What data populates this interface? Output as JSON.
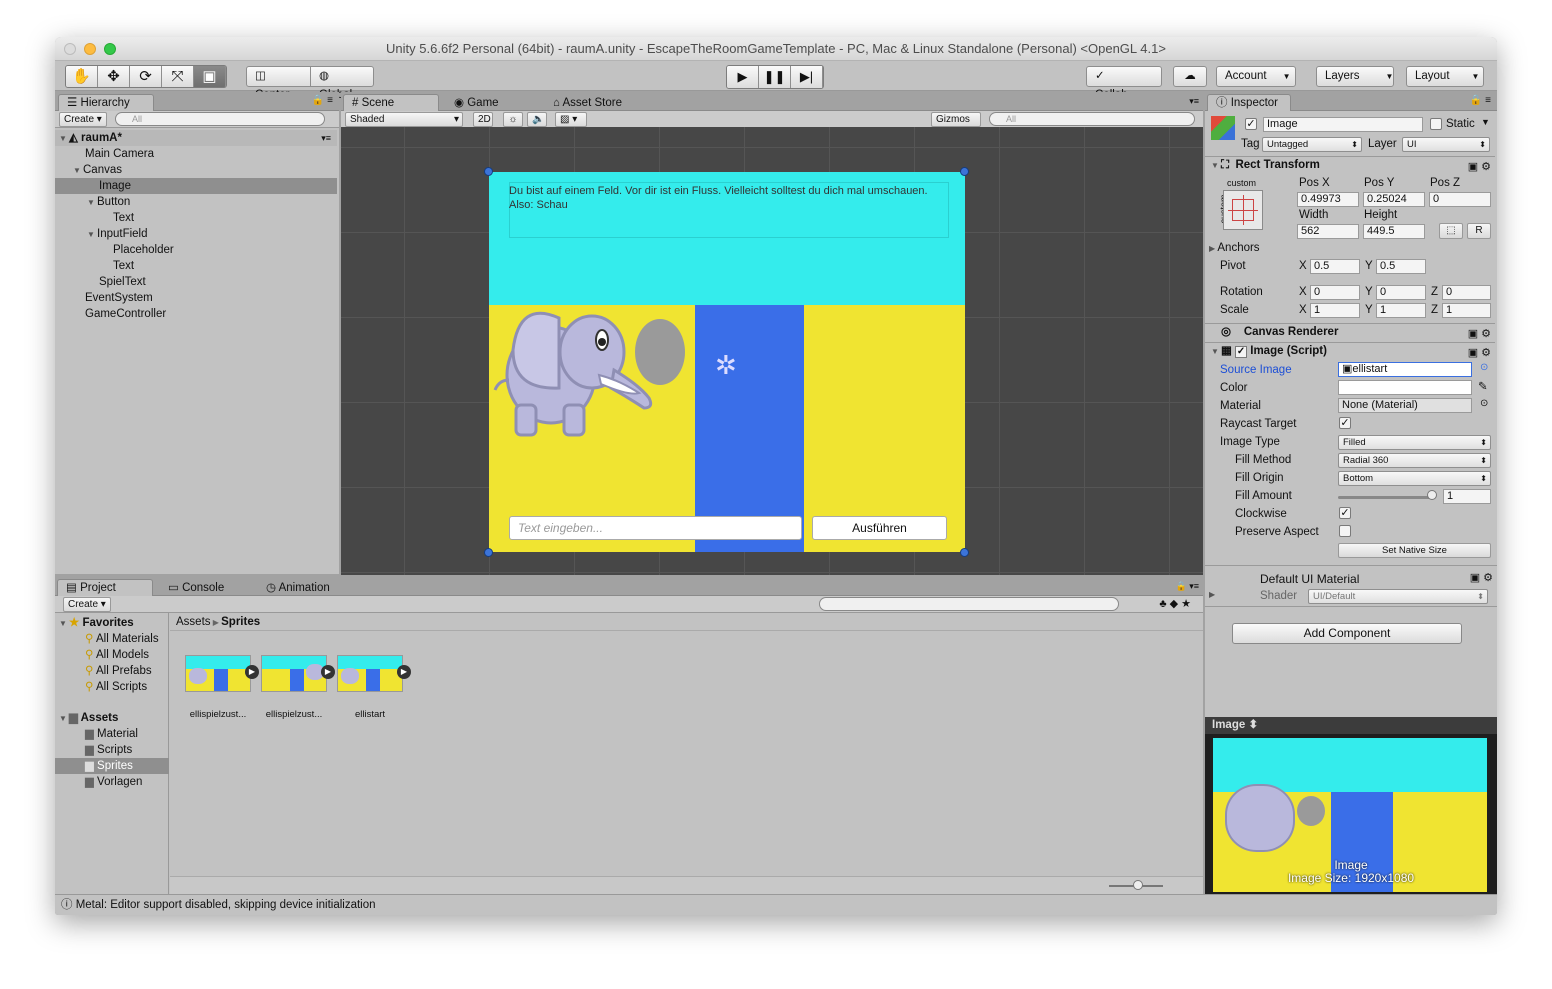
{
  "window": {
    "title": "Unity 5.6.6f2 Personal (64bit) - raumA.unity - EscapeTheRoomGameTemplate - PC, Mac & Linux Standalone (Personal) <OpenGL 4.1>"
  },
  "toolbar": {
    "center": "Center",
    "global": "Global",
    "collab": "Collab",
    "account": "Account",
    "layers": "Layers",
    "layout": "Layout"
  },
  "hierarchy": {
    "tab": "Hierarchy",
    "create": "Create",
    "search_placeholder": "All",
    "scene": "raumA*",
    "items": [
      "Main Camera",
      "Canvas",
      "Image",
      "Button",
      "Text",
      "InputField",
      "Placeholder",
      "Text",
      "SpielText",
      "EventSystem",
      "GameController"
    ]
  },
  "scene": {
    "tabs": [
      "Scene",
      "Game",
      "Asset Store"
    ],
    "shading": "Shaded",
    "mode_2d": "2D",
    "gizmos": "Gizmos",
    "search_placeholder": "All",
    "game_text": "Du bist auf einem Feld. Vor dir ist ein Fluss. Vielleicht solltest du dich mal umschauen. Also: Schau",
    "input_placeholder": "Text eingeben...",
    "button_label": "Ausführen"
  },
  "inspector": {
    "tab": "Inspector",
    "object_name": "Image",
    "static_label": "Static",
    "tag_label": "Tag",
    "tag_value": "Untagged",
    "layer_label": "Layer",
    "layer_value": "UI",
    "rect": {
      "title": "Rect Transform",
      "anchor_preset": "custom",
      "anchor_side": "custom",
      "pos_x_label": "Pos X",
      "pos_y_label": "Pos Y",
      "pos_z_label": "Pos Z",
      "pos_x": "0.49973",
      "pos_y": "0.25024",
      "pos_z": "0",
      "width_label": "Width",
      "height_label": "Height",
      "width": "562",
      "height": "449.5",
      "r_button": "R",
      "anchors": "Anchors",
      "pivot_label": "Pivot",
      "pivot_x": "0.5",
      "pivot_y": "0.5",
      "rotation_label": "Rotation",
      "rot_x": "0",
      "rot_y": "0",
      "rot_z": "0",
      "scale_label": "Scale",
      "scale_x": "1",
      "scale_y": "1",
      "scale_z": "1",
      "x": "X",
      "y": "Y",
      "z": "Z"
    },
    "canvas_renderer": "Canvas Renderer",
    "image_script": {
      "title": "Image (Script)",
      "source_image_label": "Source Image",
      "source_image": "ellistart",
      "color_label": "Color",
      "material_label": "Material",
      "material": "None (Material)",
      "raycast_label": "Raycast Target",
      "image_type_label": "Image Type",
      "image_type": "Filled",
      "fill_method_label": "Fill Method",
      "fill_method": "Radial 360",
      "fill_origin_label": "Fill Origin",
      "fill_origin": "Bottom",
      "fill_amount_label": "Fill Amount",
      "fill_amount": "1",
      "clockwise_label": "Clockwise",
      "preserve_label": "Preserve Aspect",
      "native_size": "Set Native Size"
    },
    "material": {
      "title": "Default UI Material",
      "shader_label": "Shader",
      "shader": "UI/Default"
    },
    "add_component": "Add Component",
    "preview": {
      "title": "Image",
      "caption": "Image",
      "size": "Image Size: 1920x1080"
    }
  },
  "project": {
    "tabs": [
      "Project",
      "Console",
      "Animation"
    ],
    "create": "Create",
    "favorites": "Favorites",
    "fav_items": [
      "All Materials",
      "All Models",
      "All Prefabs",
      "All Scripts"
    ],
    "assets": "Assets",
    "folders": [
      "Material",
      "Scripts",
      "Sprites",
      "Vorlagen"
    ],
    "breadcrumb": [
      "Assets",
      "Sprites"
    ],
    "files": [
      "ellispielzust...",
      "ellispielzust...",
      "ellistart"
    ]
  },
  "status": "Metal: Editor support disabled, skipping device initialization",
  "colors": {
    "cyan": "#34ecec",
    "yellow": "#f0e431",
    "blue": "#3a6ee8",
    "selection": "#8f8f8f"
  }
}
